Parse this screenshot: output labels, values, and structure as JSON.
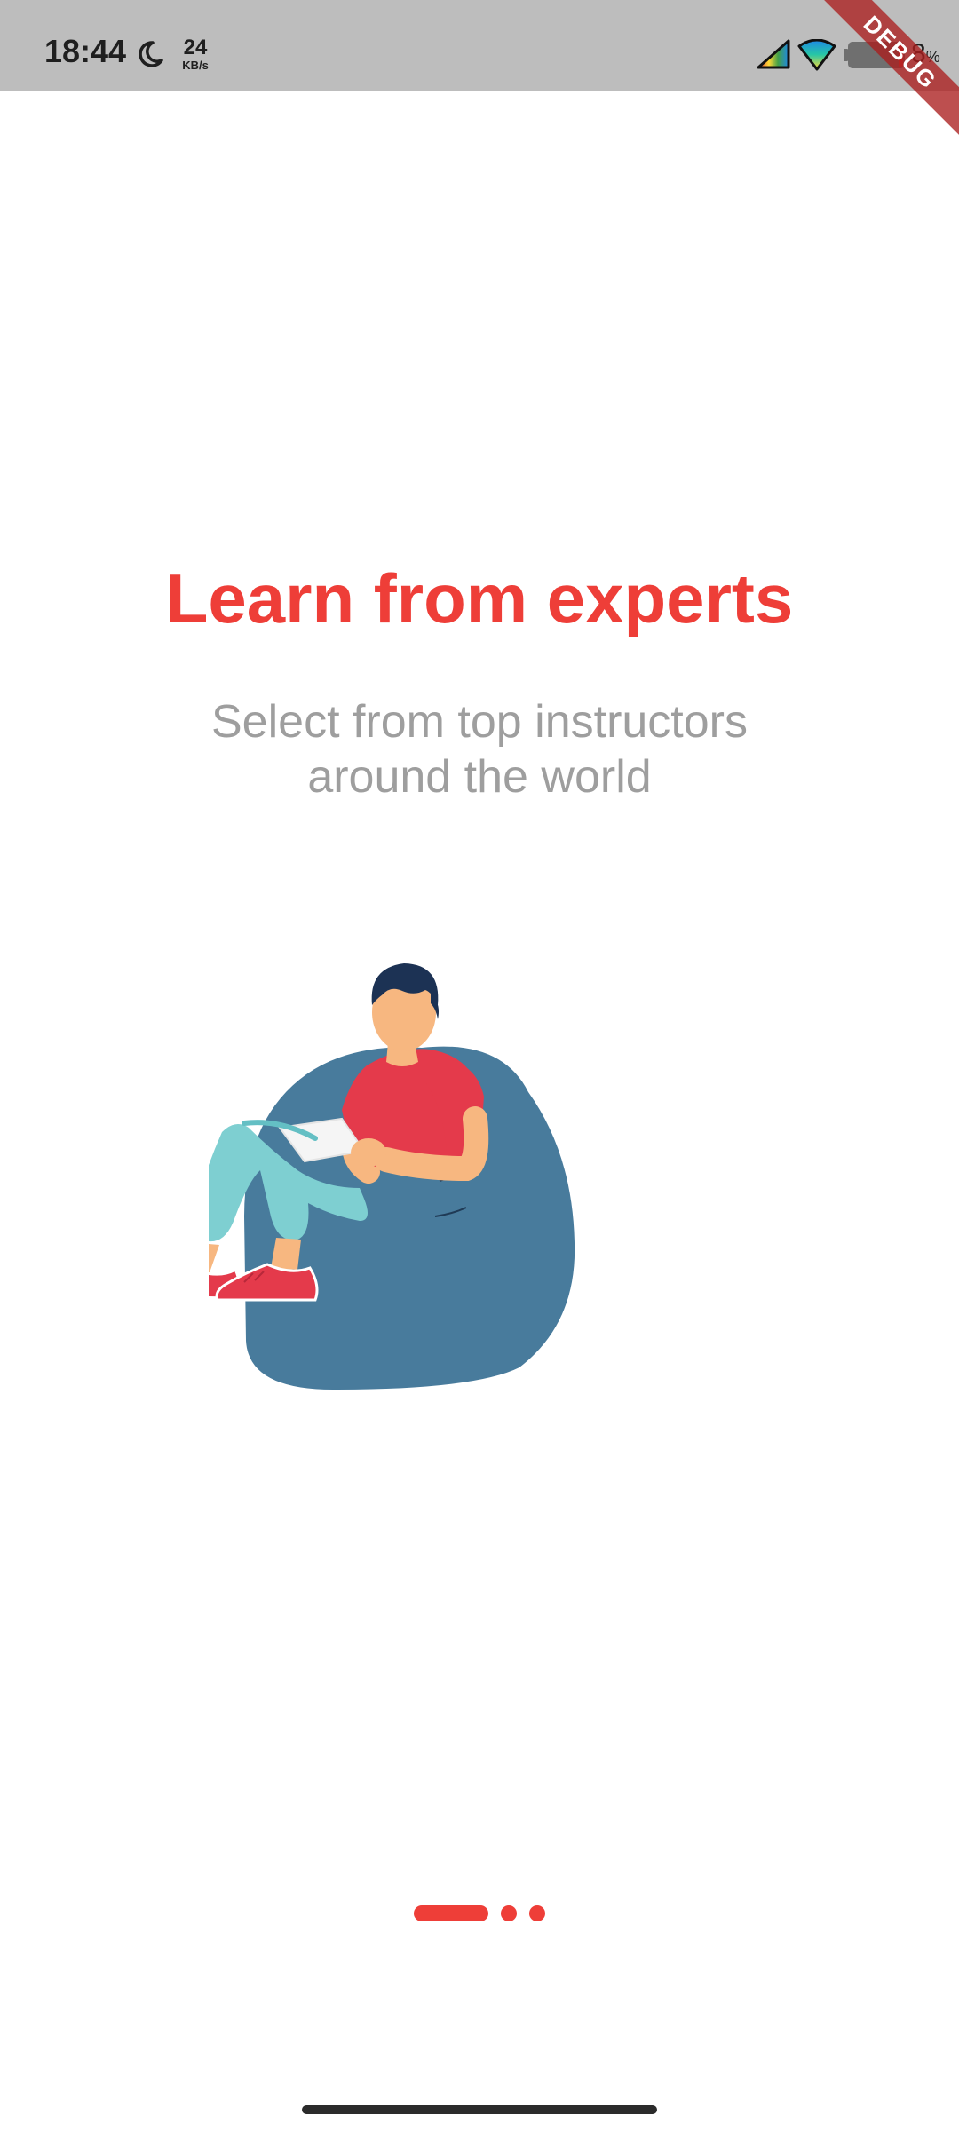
{
  "status_bar": {
    "time": "18:44",
    "net_speed_value": "24",
    "net_speed_unit": "KB/s",
    "battery_percent": "8",
    "battery_percent_sign": "%",
    "debug_banner": "DEBUG",
    "icons": [
      "moon-icon",
      "signal-icon",
      "wifi-icon",
      "battery-icon"
    ]
  },
  "onboarding": {
    "title": "Learn from experts",
    "subtitle_line1": "Select from top instructors",
    "subtitle_line2": "around the world",
    "illustration": "person-reading-on-beanbag-illustration"
  },
  "page_indicator": {
    "total_pages": 3,
    "current_page": 1
  },
  "colors": {
    "accent": "#ee3e38",
    "subtitle": "#9e9e9e",
    "status_bar": "#bdbdbd",
    "beanbag": "#487b9c",
    "shirt": "#e43a4b",
    "pants": "#7ecfd1",
    "skin": "#f7b780",
    "hair": "#1c3254"
  }
}
